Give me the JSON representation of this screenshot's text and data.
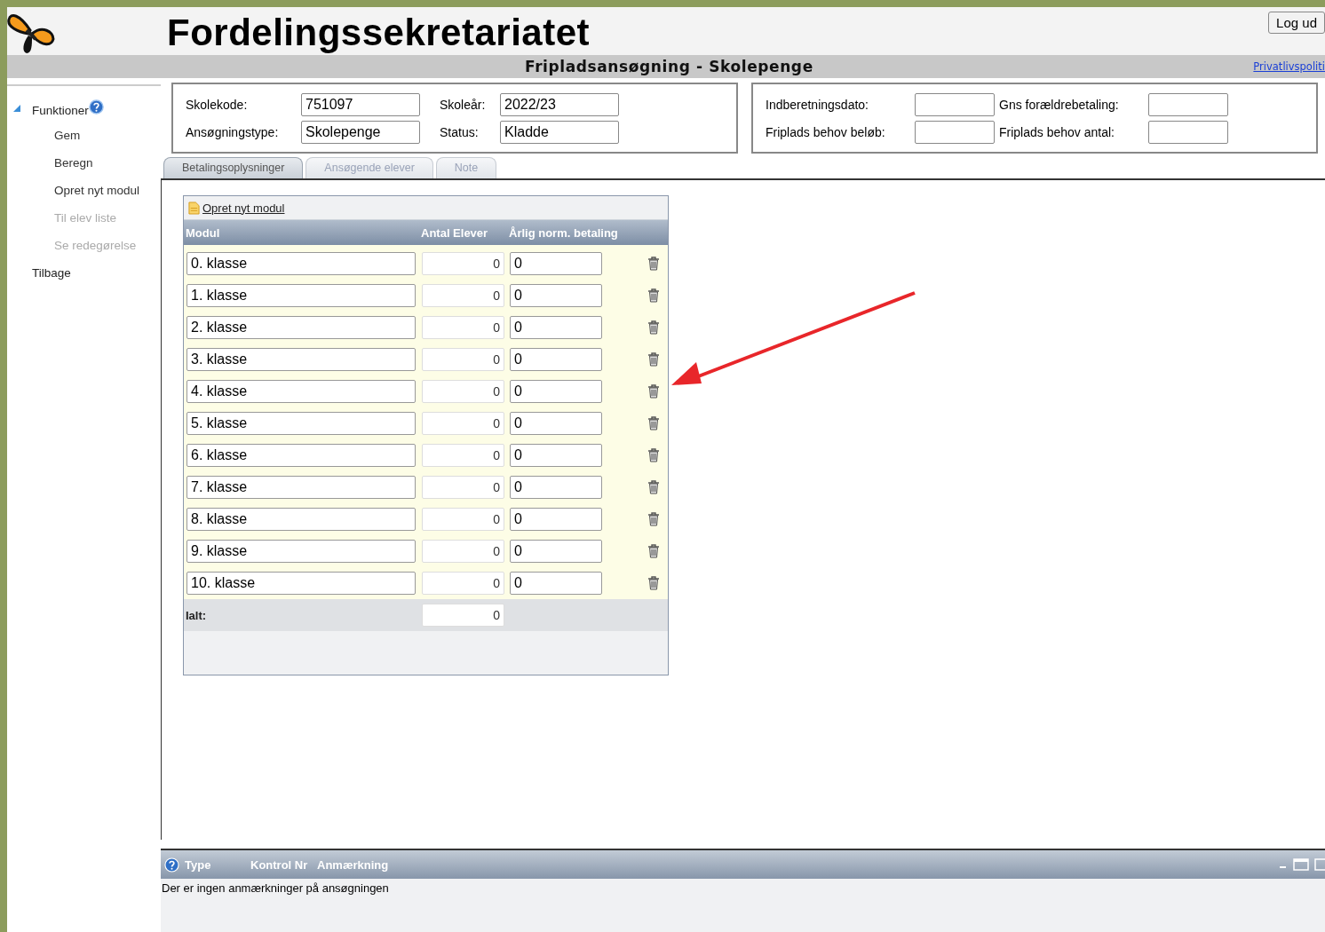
{
  "header": {
    "title": "Fordelingssekretariatet",
    "subtitle": "Fripladsansøgning - Skolepenge",
    "logout": "Log ud",
    "privacy_link": "Privatlivspoliti"
  },
  "sidebar": {
    "heading": "Funktioner",
    "expanded": true,
    "items": [
      {
        "label": "Gem",
        "disabled": false
      },
      {
        "label": "Beregn",
        "disabled": false
      },
      {
        "label": "Opret nyt modul",
        "disabled": false
      },
      {
        "label": "Til elev liste",
        "disabled": true
      },
      {
        "label": "Se redegørelse",
        "disabled": true
      }
    ],
    "back": "Tilbage"
  },
  "form_left": [
    {
      "label": "Skolekode:",
      "value": "751097"
    },
    {
      "label": "Skoleår:",
      "value": "2022/23"
    },
    {
      "label": "Ansøgningstype:",
      "value": "Skolepenge"
    },
    {
      "label": "Status:",
      "value": "Kladde"
    }
  ],
  "form_right": [
    {
      "label": "Indberetningsdato:"
    },
    {
      "label": "Gns forældrebetaling:"
    },
    {
      "label": "Friplads behov beløb:"
    },
    {
      "label": "Friplads behov antal:"
    }
  ],
  "tabs": [
    {
      "label": "Betalingsoplysninger",
      "selected": true
    },
    {
      "label": "Ansøgende elever",
      "selected": false
    },
    {
      "label": "Note",
      "selected": false
    }
  ],
  "table": {
    "action": "Opret nyt modul",
    "columns": [
      "Modul",
      "Antal Elever",
      "Årlig norm. betaling"
    ],
    "rows": [
      {
        "modul": "0. klasse",
        "count": "0",
        "payment": "0"
      },
      {
        "modul": "1. klasse",
        "count": "0",
        "payment": "0"
      },
      {
        "modul": "2. klasse",
        "count": "0",
        "payment": "0"
      },
      {
        "modul": "3. klasse",
        "count": "0",
        "payment": "0"
      },
      {
        "modul": "4. klasse",
        "count": "0",
        "payment": "0"
      },
      {
        "modul": "5. klasse",
        "count": "0",
        "payment": "0"
      },
      {
        "modul": "6. klasse",
        "count": "0",
        "payment": "0"
      },
      {
        "modul": "7. klasse",
        "count": "0",
        "payment": "0"
      },
      {
        "modul": "8. klasse",
        "count": "0",
        "payment": "0"
      },
      {
        "modul": "9. klasse",
        "count": "0",
        "payment": "0"
      },
      {
        "modul": "10. klasse",
        "count": "0",
        "payment": "0"
      }
    ],
    "total": {
      "label": "Ialt:",
      "value": "0"
    }
  },
  "remarks": {
    "columns": [
      "Type",
      "Kontrol Nr",
      "Anmærkning"
    ],
    "message": "Der er ingen anmærkninger på ansøgningen"
  }
}
